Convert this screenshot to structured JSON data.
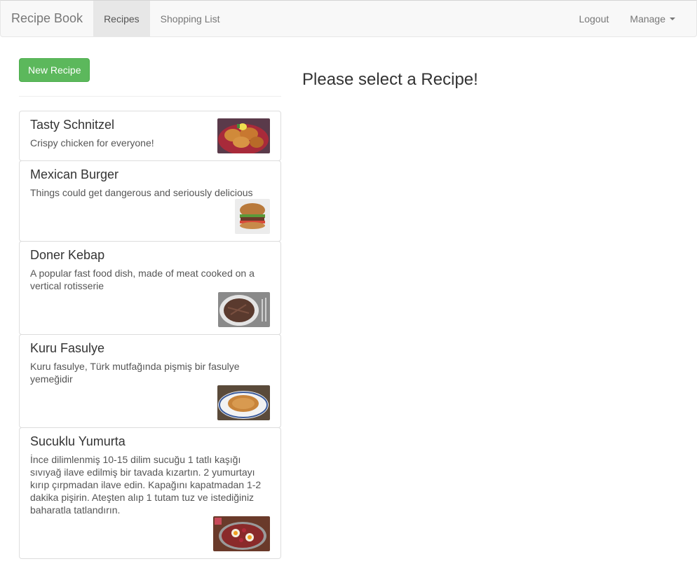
{
  "navbar": {
    "brand": "Recipe Book",
    "left_items": [
      {
        "label": "Recipes",
        "active": true
      },
      {
        "label": "Shopping List",
        "active": false
      }
    ],
    "right_items": [
      {
        "label": "Logout"
      },
      {
        "label": "Manage"
      }
    ]
  },
  "sidebar": {
    "new_button_label": "New Recipe",
    "recipes": [
      {
        "name": "Tasty Schnitzel",
        "description": "Crispy chicken for everyone!"
      },
      {
        "name": "Mexican Burger",
        "description": "Things could get dangerous and seriously delicious"
      },
      {
        "name": "Doner Kebap",
        "description": "A popular fast food dish, made of meat cooked on a vertical rotisserie"
      },
      {
        "name": "Kuru Fasulye",
        "description": "Kuru fasulye, Türk mutfağında pişmiş bir fasulye yemeğidir"
      },
      {
        "name": "Sucuklu Yumurta",
        "description": "İnce dilimlenmiş 10-15 dilim sucuğu 1 tatlı kaşığı sıvıyağ ilave edilmiş bir tavada kızartın. 2 yumurtayı kırıp çırpmadan ilave edin. Kapağını kapatmadan 1-2 dakika pişirin. Ateşten alıp 1 tutam tuz ve istediğiniz baharatla tatlandırın."
      }
    ]
  },
  "main": {
    "placeholder": "Please select a Recipe!"
  },
  "colors": {
    "accent_green": "#5cb85c",
    "navbar_bg": "#f8f8f8"
  }
}
